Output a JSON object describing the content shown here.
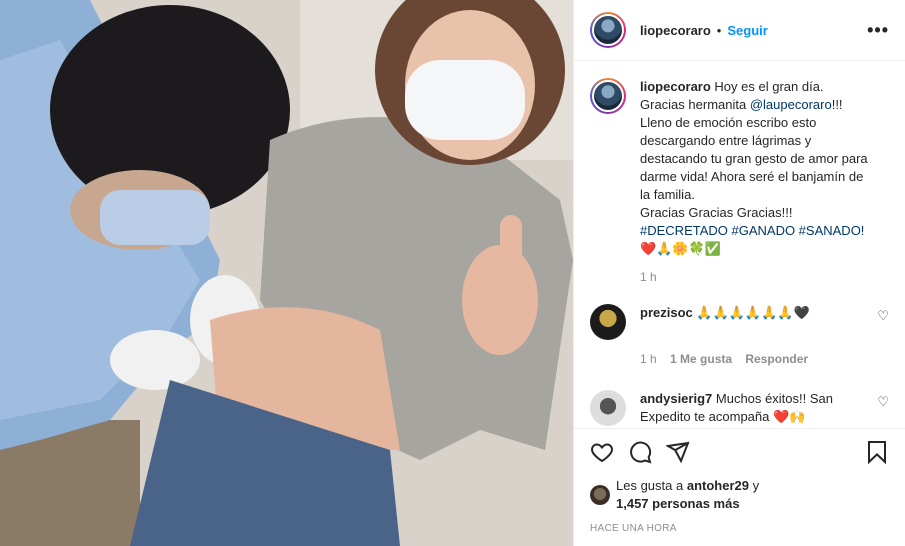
{
  "post": {
    "username": "liopecoraro",
    "follow_label": "Seguir",
    "more": "•••"
  },
  "caption": {
    "username": "liopecoraro",
    "text_1": "Hoy es el gran día. Gracias hermanita",
    "mention": "@laupecoraro",
    "text_2": "!!! Lleno de emoción escribo esto descargando entre lágrimas y destacando tu gran gesto de amor para darme vida! Ahora seré el banjamín de la familia.",
    "text_3": "Gracias Gracias Gracias!!!",
    "hashtags": "#DECRETADO #GANADO #SANADO!",
    "emojis": "❤️🙏🌼🍀✅",
    "time": "1 h"
  },
  "comments": [
    {
      "username": "prezisoc",
      "text": "🙏🙏🙏🙏🙏🙏🖤",
      "time": "1 h",
      "likes": "1 Me gusta",
      "reply": "Responder"
    },
    {
      "username": "andysierig7",
      "text": "Muchos éxitos!! San Expedito te acompaña ❤️🙌"
    }
  ],
  "likes": {
    "prefix": "Les gusta a",
    "user": "antoher29",
    "mid": "y",
    "count": "1,457 personas más"
  },
  "timestamp": "Hace una hora",
  "icons": {
    "like": "heart-outline-icon",
    "comment": "comment-bubble-icon",
    "share": "paper-plane-icon",
    "save": "bookmark-icon"
  },
  "colors": {
    "link": "#0095f6",
    "mention": "#00376b",
    "muted": "#8e8e8e"
  }
}
